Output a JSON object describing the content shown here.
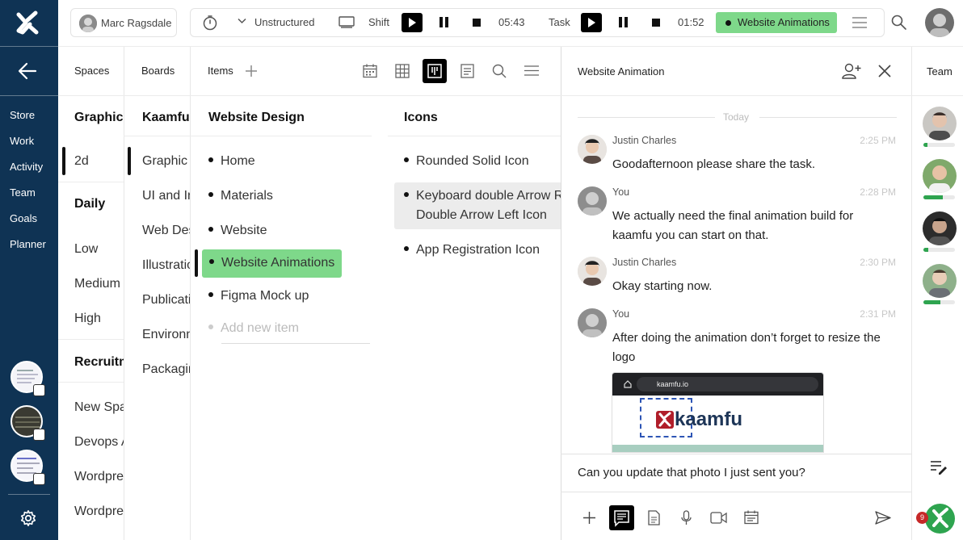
{
  "topbar": {
    "user_name": "Marc Ragsdale",
    "mode_label": "Unstructured",
    "shift_label": "Shift",
    "shift_time": "05:43",
    "task_label": "Task",
    "task_time": "01:52",
    "active_task": "Website Animations",
    "active_task_color": "#7ed88a"
  },
  "sidebar": {
    "items": [
      {
        "label": "Store"
      },
      {
        "label": "Work"
      },
      {
        "label": "Activity"
      },
      {
        "label": "Team"
      },
      {
        "label": "Goals"
      },
      {
        "label": "Planner"
      }
    ],
    "bg_color": "#0f3354"
  },
  "columns": {
    "spaces_header": "Spaces",
    "boards_header": "Boards",
    "items_header": "Items"
  },
  "spaces": {
    "groups": [
      {
        "title": "Graphic D",
        "items": [
          "2d"
        ]
      },
      {
        "title": "Daily",
        "items": [
          "Low",
          "Medium",
          "High"
        ]
      },
      {
        "title": "Recruitm",
        "items": [
          "New Spa",
          "Devops A",
          "Wordpres",
          "Wordpres"
        ]
      }
    ]
  },
  "boards": {
    "title": "Kaamfu",
    "items": [
      "Graphic",
      "UI and In",
      "Web Des",
      "Illustratio",
      "Publicati",
      "Environn",
      "Packagin"
    ]
  },
  "items_list": {
    "title": "Website Design",
    "items": [
      "Home",
      "Materials",
      "Website",
      "Website Animations",
      "Figma Mock up"
    ],
    "add_placeholder": "Add new item"
  },
  "icons_list": {
    "title": "Icons",
    "items": [
      "Rounded Solid Icon",
      "Keyboard double Arrow Ri",
      "Double Arrow Left Icon",
      "App Registration Icon"
    ]
  },
  "chat": {
    "title": "Website Animation",
    "day_label": "Today",
    "messages": [
      {
        "author": "Justin Charles",
        "time": "2:25 PM",
        "text": "Goodafternoon please share the task."
      },
      {
        "author": "You",
        "time": "2:28 PM",
        "text": "We actually need the final animation build for kaamfu you can start on that."
      },
      {
        "author": "Justin Charles",
        "time": "2:30 PM",
        "text": "Okay starting now."
      },
      {
        "author": "You",
        "time": "2:31 PM",
        "text": "After doing the animation don’t forget to resize the logo"
      }
    ],
    "attachment": {
      "url": "kaamfu.io",
      "logo_text": "kaamfu"
    },
    "composer_value": "Can you update that photo I just sent you?"
  },
  "team": {
    "header": "Team",
    "members": [
      {
        "progress": 0.12
      },
      {
        "progress": 0.62
      },
      {
        "progress": 0.15
      },
      {
        "progress": 0.55
      }
    ],
    "notification_count": "9"
  }
}
